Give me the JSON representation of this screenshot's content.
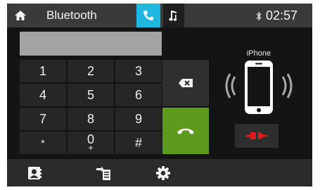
{
  "header": {
    "title": "Bluetooth",
    "time": "02:57",
    "tabs": [
      {
        "icon": "phone-icon",
        "active": true,
        "color": "#1fb6e0"
      },
      {
        "icon": "music-note-icon",
        "active": false
      }
    ]
  },
  "dialer": {
    "number": "",
    "keys": [
      "1",
      "2",
      "3",
      "4",
      "5",
      "6",
      "7",
      "8",
      "9",
      "*",
      "0",
      "#"
    ],
    "zero_sub": "+",
    "backspace_icon": "backspace-icon",
    "call_icon": "call-icon",
    "call_color": "#5d9a1e"
  },
  "device": {
    "name": "iPhone",
    "icon": "phone-vibrating-icon",
    "disconnect_icon": "disconnect-icon",
    "disconnect_color": "#e0191b"
  },
  "bottom_bar": {
    "items": [
      {
        "icon": "contacts-icon"
      },
      {
        "icon": "call-log-icon"
      },
      {
        "icon": "settings-gear-icon"
      }
    ]
  }
}
